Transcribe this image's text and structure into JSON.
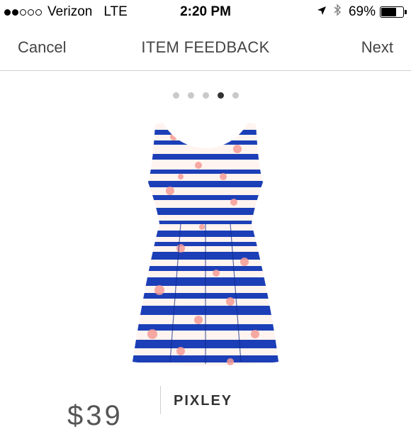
{
  "status_bar": {
    "signal_strength": 2,
    "signal_max": 5,
    "carrier": "Verizon",
    "network": "LTE",
    "time": "2:20 PM",
    "battery_percent": "69%",
    "battery_level": 0.69,
    "icons": [
      "location-arrow-icon",
      "bluetooth-icon",
      "battery-icon"
    ]
  },
  "nav": {
    "cancel_label": "Cancel",
    "title": "ITEM FEEDBACK",
    "next_label": "Next"
  },
  "pager": {
    "count": 5,
    "active_index": 3
  },
  "product": {
    "image_icon": "striped-floral-dress",
    "colors": {
      "stripe_blue": "#1c3fb8",
      "floral_pink": "#f59a95",
      "base": "#fff4ef"
    }
  },
  "item": {
    "brand": "PIXLEY",
    "price_partial": "$39"
  }
}
